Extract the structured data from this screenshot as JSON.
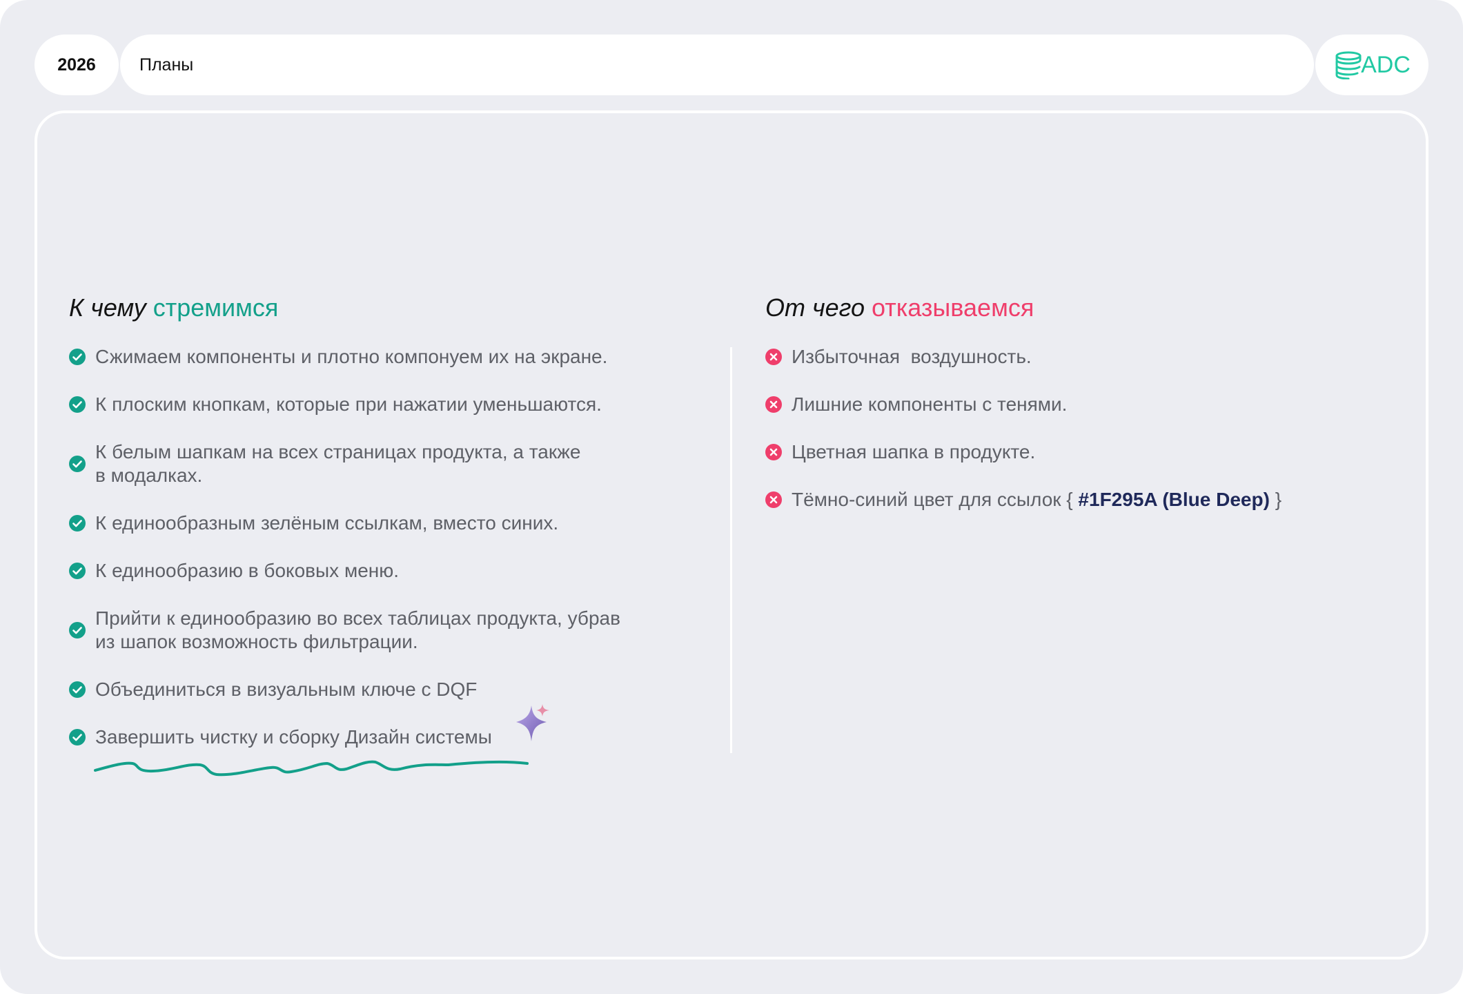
{
  "header": {
    "year": "2026",
    "title": "Планы",
    "logo_text": "ADC"
  },
  "left": {
    "title_prefix": "К чему",
    "title_accent": "стремимся",
    "items": [
      {
        "text": "Сжимаем компоненты и плотно компонуем их на экране."
      },
      {
        "text": "К плоским кнопкам, которые при нажатии уменьшаются."
      },
      {
        "text": "К белым шапкам на всех страницах продукта, а также\nв модалках."
      },
      {
        "text": "К единообразным зелёным ссылкам, вместо синих."
      },
      {
        "text": "К единообразию в боковых меню."
      },
      {
        "text": "Прийти к единообразию во всех таблицах продукта, убрав\nиз шапок возможность фильтрации."
      },
      {
        "text": "Объединиться в визуальным ключе с DQF"
      },
      {
        "text": "Завершить чистку и сборку Дизайн системы"
      }
    ]
  },
  "right": {
    "title_prefix": "От чего",
    "title_accent": "отказываемся",
    "items": [
      {
        "text": "Избыточная  воздушность."
      },
      {
        "text": "Лишние компоненты с тенями."
      },
      {
        "text": "Цветная шапка в продукте."
      }
    ],
    "last_item": {
      "before": "Тёмно-синий цвет для ссылок { ",
      "hex": "#1F295A (Blue Deep)",
      "after": " }"
    }
  },
  "icons": {
    "check": "check-circle-icon",
    "cross": "x-circle-icon",
    "sparkle": "sparkle-icon"
  },
  "colors": {
    "background": "#ECEDF2",
    "accent_green": "#13A08A",
    "accent_red": "#EF3E6B",
    "deep_blue": "#1F295A",
    "logo_teal": "#21C9A3"
  }
}
